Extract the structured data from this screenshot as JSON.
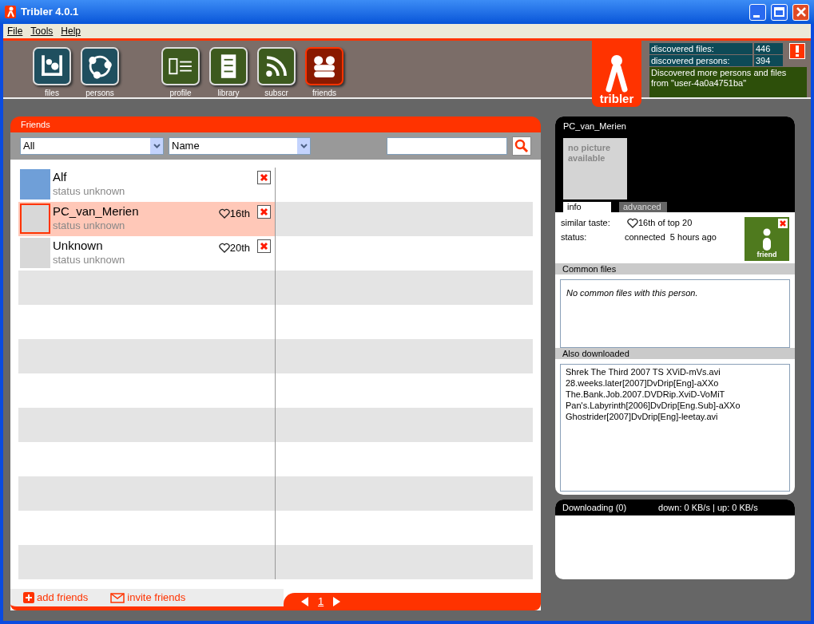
{
  "window": {
    "title": "Tribler 4.0.1"
  },
  "menu": [
    "File",
    "Tools",
    "Help"
  ],
  "toolbar": [
    {
      "label": "files",
      "kind": "files",
      "selected": false
    },
    {
      "label": "persons",
      "kind": "persons",
      "selected": false
    },
    {
      "label": "profile",
      "kind": "profile",
      "selected": false
    },
    {
      "label": "library",
      "kind": "library",
      "selected": false
    },
    {
      "label": "subscr",
      "kind": "subscr",
      "selected": false
    },
    {
      "label": "friends",
      "kind": "friends",
      "selected": true
    }
  ],
  "logo": {
    "text": "tribler"
  },
  "stats": [
    {
      "label": "discovered files:",
      "value": "446"
    },
    {
      "label": "discovered persons:",
      "value": "394"
    }
  ],
  "notification": "Discovered more persons and files from \"user-4a0a4751ba\"",
  "friends_panel": {
    "title": "Friends",
    "filter": "All",
    "sort": "Name",
    "friends": [
      {
        "name": "Alf",
        "status": "status unknown",
        "kind": "photo",
        "selected": false
      },
      {
        "name": "PC_van_Merien",
        "status": "status unknown",
        "kind": "placeholder",
        "rank": "16th",
        "selected": true
      },
      {
        "name": "Unknown",
        "status": "status unknown",
        "kind": "placeholder",
        "rank": "20th",
        "selected": false
      }
    ],
    "footer_links": [
      {
        "label": "add friends",
        "kind": "add"
      },
      {
        "label": "invite friends",
        "kind": "invite"
      }
    ],
    "page": "1"
  },
  "detail": {
    "name": "PC_van_Merien",
    "picture_text": "no picture available",
    "tabs": [
      {
        "label": "info",
        "selected": true
      },
      {
        "label": "advanced",
        "selected": false
      }
    ],
    "fields": [
      {
        "label": "similar taste:",
        "value": "16th of top 20",
        "heart": true
      },
      {
        "label": "status:",
        "value": "connected  5 hours ago",
        "heart": false
      }
    ],
    "badge": "friend",
    "common_files": {
      "title": "Common files",
      "message": "No common files with this person."
    },
    "also_downloaded": {
      "title": "Also downloaded",
      "files": [
        "Shrek The Third 2007 TS XViD-mVs.avi",
        "28.weeks.later[2007]DvDrip[Eng]-aXXo",
        "The.Bank.Job.2007.DVDRip.XviD-VoMiT",
        "Pan's.Labyrinth[2006]DvDrip[Eng.Sub]-aXXo",
        "Ghostrider[2007]DvDrip[Eng]-leetay.avi"
      ]
    }
  },
  "downloads": {
    "title": "Downloading (0)",
    "speed": "down: 0 KB/s | up: 0 KB/s"
  }
}
